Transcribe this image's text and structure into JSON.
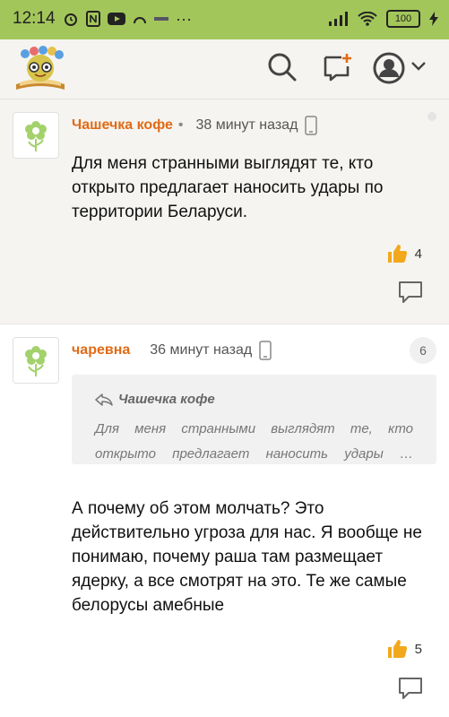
{
  "status_bar": {
    "time": "12:14",
    "battery": "100"
  },
  "header": {
    "logo_alt": "logo"
  },
  "comments": [
    {
      "author": "Чашечка кофе",
      "time": "38 минут назад",
      "text": "Для меня странными выглядят те, кто открыто предлагает наносить удары по территории Беларуси.",
      "likes": "4"
    },
    {
      "author": "чаревна",
      "time": "36 минут назад",
      "badge": "6",
      "quote_author": "Чашечка кофе",
      "quote_text": "Для меня странными выглядят те, кто открыто предлагает наносить удары …",
      "text": "А почему об этом молчать? Это действительно угроза для нас. Я вообще не понимаю, почему раша там размещает ядерку, а все смотрят на это. Те же самые белорусы амебные",
      "likes": "5"
    }
  ],
  "colors": {
    "status_bar": "#a3c65a",
    "author": "#e06b16",
    "like_icon": "#f2a81d"
  },
  "icons": [
    "search-icon",
    "add-message-icon",
    "profile-icon",
    "chevron-down-icon",
    "phone-icon",
    "thumbs-up-icon",
    "reply-icon"
  ]
}
